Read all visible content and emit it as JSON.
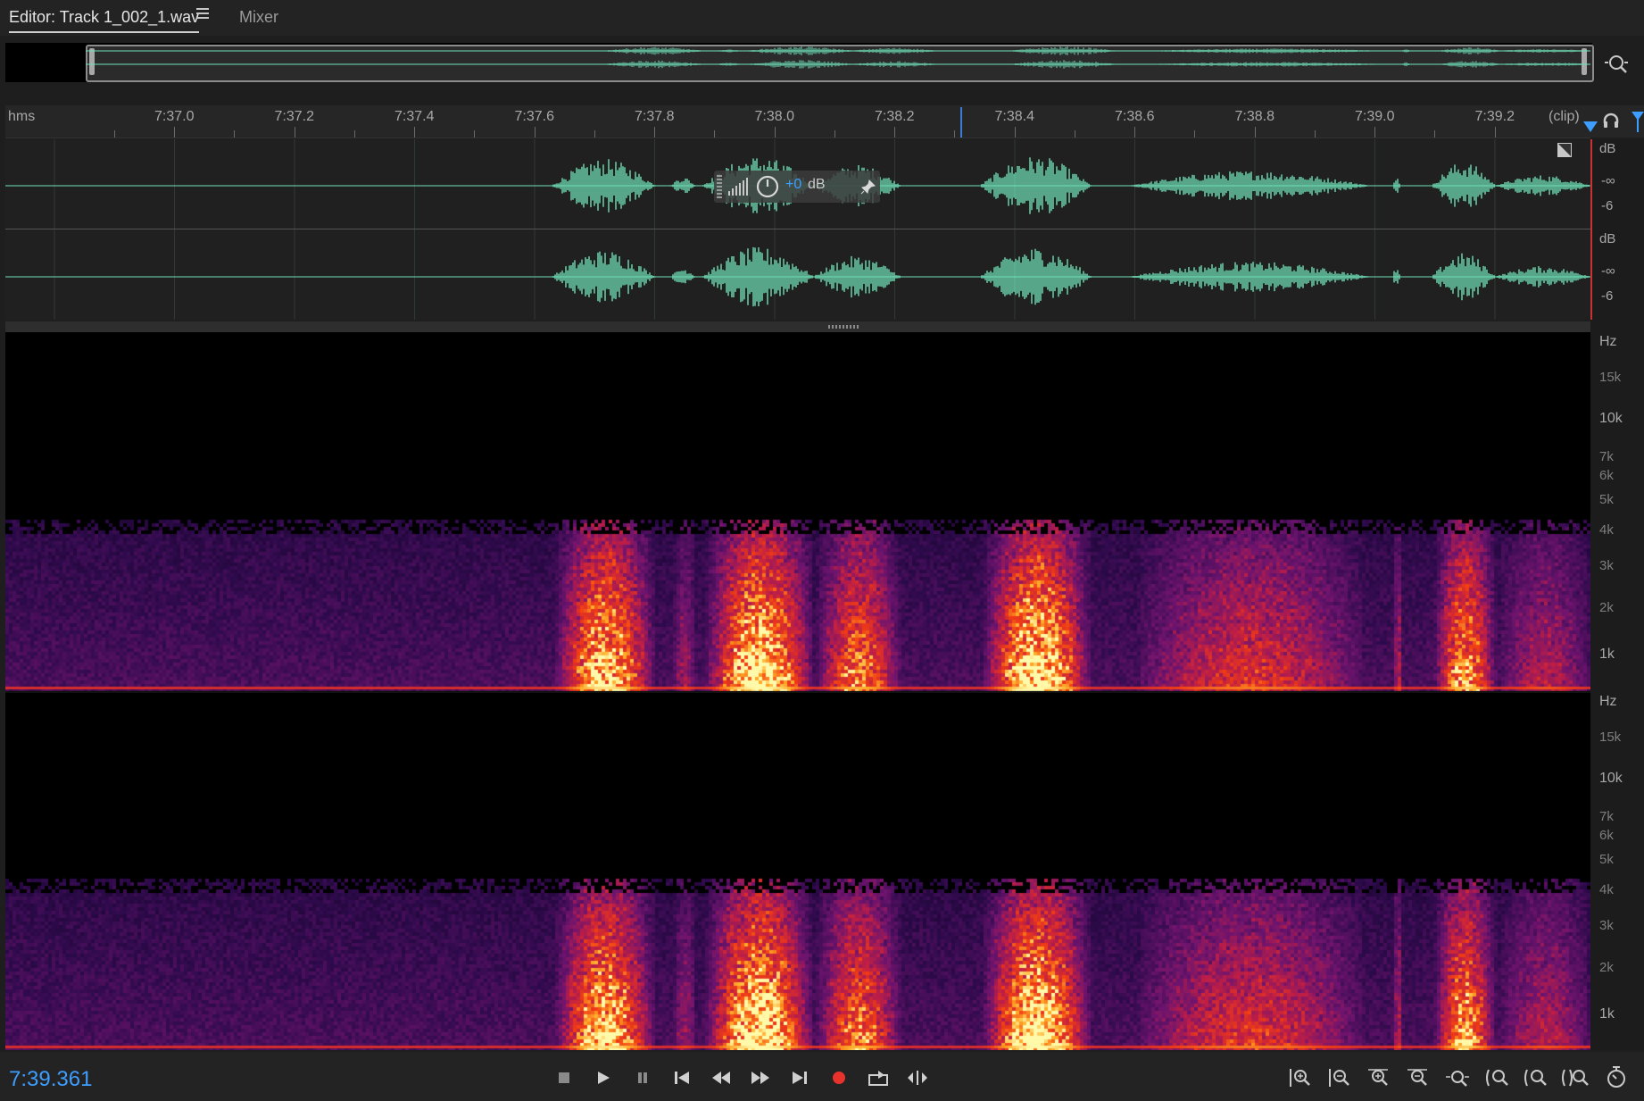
{
  "tabs": {
    "editor_label": "Editor: Track 1_002_1.wav",
    "mixer_label": "Mixer"
  },
  "ruler": {
    "unit_label": "hms",
    "clip_label": "(clip)",
    "ticks": [
      {
        "label": "7:37.0",
        "time": 457.0
      },
      {
        "label": "7:37.2",
        "time": 457.2
      },
      {
        "label": "7:37.4",
        "time": 457.4
      },
      {
        "label": "7:37.6",
        "time": 457.6
      },
      {
        "label": "7:37.8",
        "time": 457.8
      },
      {
        "label": "7:38.0",
        "time": 458.0
      },
      {
        "label": "7:38.2",
        "time": 458.2
      },
      {
        "label": "7:38.4",
        "time": 458.4
      },
      {
        "label": "7:38.6",
        "time": 458.6
      },
      {
        "label": "7:38.8",
        "time": 458.8
      },
      {
        "label": "7:39.0",
        "time": 459.0
      },
      {
        "label": "7:39.2",
        "time": 459.2
      }
    ]
  },
  "waveform": {
    "db_unit": "dB",
    "labels": [
      "-∞",
      "-6"
    ]
  },
  "hud": {
    "volume_value": "+0",
    "volume_unit": "dB"
  },
  "spectrum": {
    "hz_unit": "Hz",
    "labels": [
      {
        "label": "15k",
        "minor": true
      },
      {
        "label": "10k",
        "minor": false
      },
      {
        "label": "7k",
        "minor": true
      },
      {
        "label": "6k",
        "minor": true
      },
      {
        "label": "5k",
        "minor": true
      },
      {
        "label": "4k",
        "minor": true
      },
      {
        "label": "3k",
        "minor": true
      },
      {
        "label": "2k",
        "minor": true
      },
      {
        "label": "1k",
        "minor": false
      }
    ]
  },
  "transport": {
    "time_readout": "7:39.361"
  },
  "colors": {
    "accent": "#3d9eff",
    "waveform": "#6fe0b8",
    "record": "#e8322c"
  }
}
